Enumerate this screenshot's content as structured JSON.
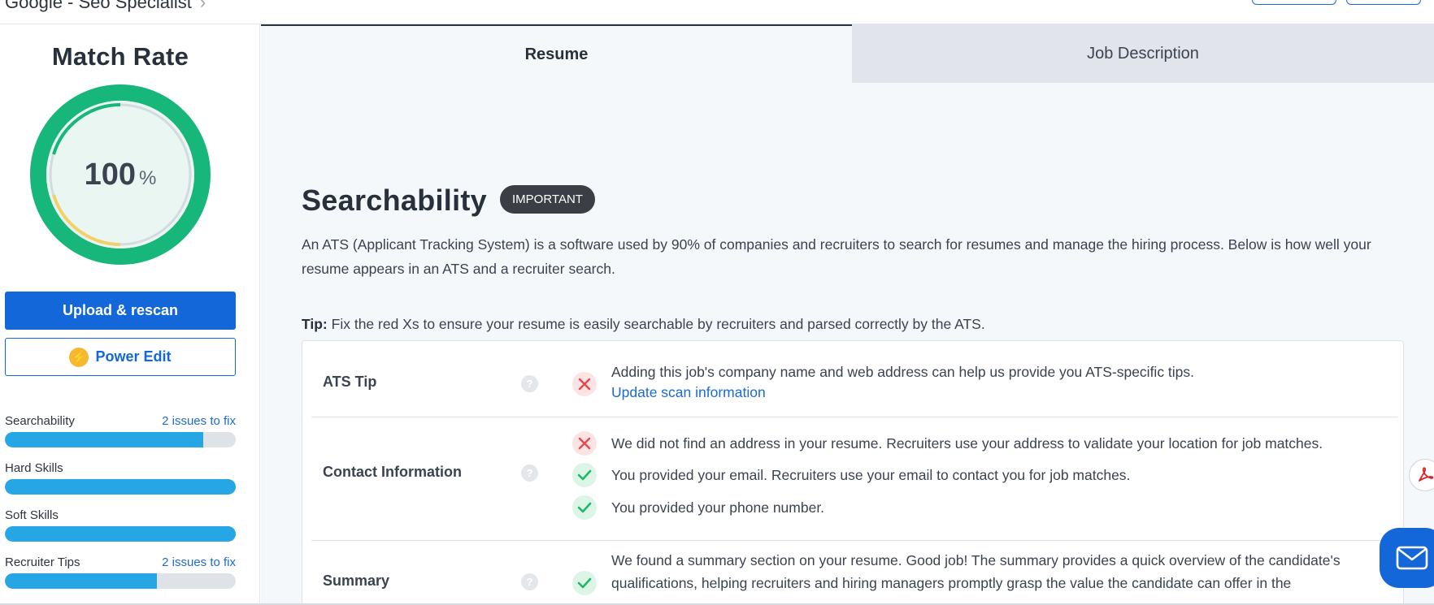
{
  "header": {
    "breadcrumb": "Google - Seo Specialist",
    "separator": "›"
  },
  "sidebar": {
    "match_title": "Match Rate",
    "match_value": "100",
    "match_unit": "%",
    "match_fraction": 1.0,
    "upload_button": "Upload & rescan",
    "power_edit_button": "Power Edit",
    "metrics": [
      {
        "label": "Searchability",
        "issues": "2 issues to fix",
        "progress": 0.86
      },
      {
        "label": "Hard Skills",
        "issues": "",
        "progress": 1.0
      },
      {
        "label": "Soft Skills",
        "issues": "",
        "progress": 1.0
      },
      {
        "label": "Recruiter Tips",
        "issues": "2 issues to fix",
        "progress": 0.66
      }
    ]
  },
  "tabs": [
    {
      "label": "Resume",
      "active": true
    },
    {
      "label": "Job Description",
      "active": false
    }
  ],
  "section": {
    "title": "Searchability",
    "badge": "IMPORTANT",
    "description": "An ATS (Applicant Tracking System) is a software used by 90% of companies and recruiters to search for resumes and manage the hiring process. Below is how well your resume appears in an ATS and a recruiter search.",
    "tip_label": "Tip:",
    "tip_text": "Fix the red Xs to ensure your resume is easily searchable by recruiters and parsed correctly by the ATS."
  },
  "checks": {
    "ats_tip": {
      "category": "ATS Tip",
      "message": "Adding this job's company name and web address can help us provide you ATS-specific tips.",
      "link": "Update scan information"
    },
    "contact": {
      "category": "Contact Information",
      "address": "We did not find an address in your resume. Recruiters use your address to validate your location for job matches.",
      "email": "You provided your email. Recruiters use your email to contact you for job matches.",
      "phone": "You provided your phone number."
    },
    "summary": {
      "category": "Summary",
      "message": "We found a summary section on your resume. Good job! The summary provides a quick overview of the candidate's qualifications, helping recruiters and hiring managers promptly grasp the value the candidate can offer in the"
    }
  },
  "colors": {
    "primary": "#1467d8",
    "gauge_ring": "#17b67a",
    "progress": "#27a6e5",
    "error": "#e5484d",
    "success": "#1fb86a"
  },
  "icons": [
    "help-icon",
    "x-icon",
    "check-icon",
    "bolt-icon",
    "pdf-icon",
    "mail-icon"
  ]
}
